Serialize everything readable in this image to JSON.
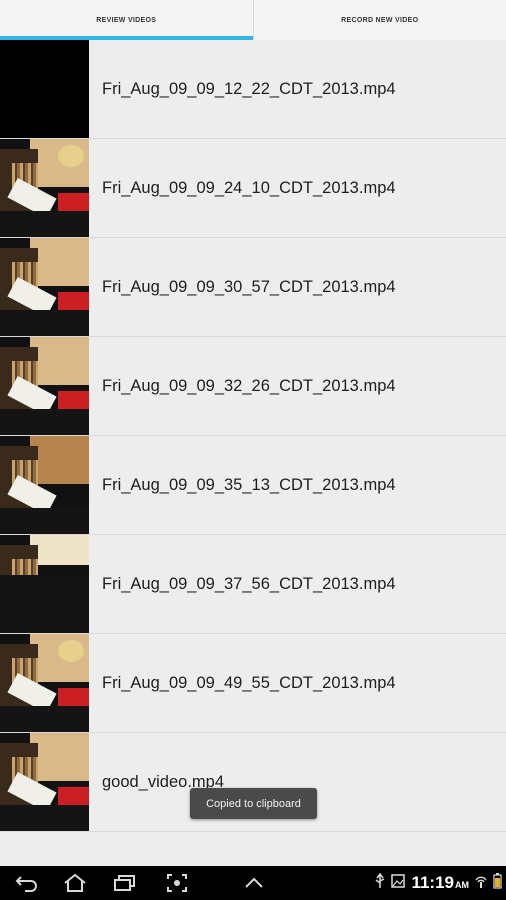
{
  "tabs": [
    {
      "label": "REVIEW VIDEOS",
      "active": true
    },
    {
      "label": "RECORD NEW VIDEO",
      "active": false
    }
  ],
  "videos": [
    {
      "filename": "Fri_Aug_09_09_12_22_CDT_2013.mp4"
    },
    {
      "filename": "Fri_Aug_09_09_24_10_CDT_2013.mp4"
    },
    {
      "filename": "Fri_Aug_09_09_30_57_CDT_2013.mp4"
    },
    {
      "filename": "Fri_Aug_09_09_32_26_CDT_2013.mp4"
    },
    {
      "filename": "Fri_Aug_09_09_35_13_CDT_2013.mp4"
    },
    {
      "filename": "Fri_Aug_09_09_37_56_CDT_2013.mp4"
    },
    {
      "filename": "Fri_Aug_09_09_49_55_CDT_2013.mp4"
    },
    {
      "filename": "good_video.mp4"
    }
  ],
  "toast": {
    "text": "Copied to clipboard"
  },
  "system_bar": {
    "nav_icons": [
      "back-icon",
      "home-icon",
      "recent-apps-icon",
      "screenshot-icon",
      "up-chevron-icon"
    ],
    "status_icons": [
      "usb-icon",
      "image-icon",
      "battery-icon"
    ],
    "time": "11:19",
    "ampm": "AM"
  },
  "colors": {
    "accent": "#33b5e5",
    "background": "#ececec",
    "navbar": "#000000",
    "toast": "#4a4a4a"
  }
}
